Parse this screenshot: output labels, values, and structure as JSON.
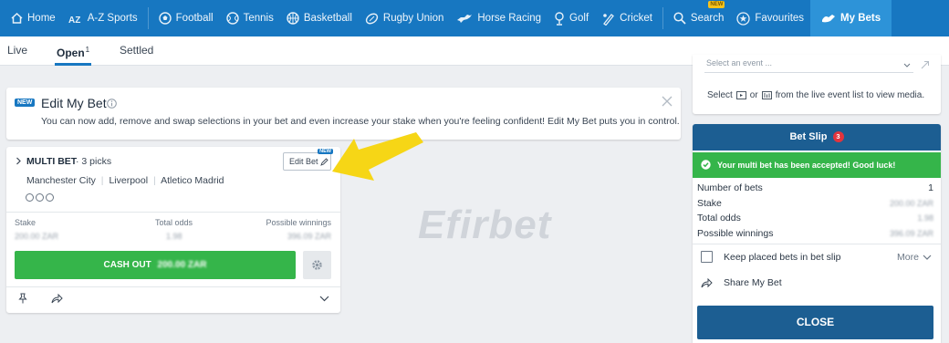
{
  "nav": {
    "items": [
      {
        "label": "Home",
        "icon": "home-icon"
      },
      {
        "label": "A-Z Sports",
        "icon": "az-sports-icon"
      },
      {
        "label": "Football",
        "icon": "football-icon"
      },
      {
        "label": "Tennis",
        "icon": "tennis-icon"
      },
      {
        "label": "Basketball",
        "icon": "basketball-icon"
      },
      {
        "label": "Rugby Union",
        "icon": "rugby-icon"
      },
      {
        "label": "Horse Racing",
        "icon": "horse-racing-icon"
      },
      {
        "label": "Golf",
        "icon": "golf-icon"
      },
      {
        "label": "Cricket",
        "icon": "cricket-icon"
      },
      {
        "label": "Search",
        "icon": "search-icon",
        "badge": "NEW"
      },
      {
        "label": "Favourites",
        "icon": "star-icon"
      },
      {
        "label": "My Bets",
        "icon": "my-bets-icon"
      }
    ]
  },
  "subtabs": {
    "live": "Live",
    "open": "Open",
    "open_count": "1",
    "settled": "Settled"
  },
  "promo": {
    "badge": "NEW",
    "title": "Edit My Bet",
    "text": "You can now add, remove and swap selections in your bet and even increase your stake when you're feeling confident! Edit My Bet puts you in control."
  },
  "bet": {
    "type": "MULTI BET",
    "picks": "· 3 picks",
    "edit_label": "Edit Bet",
    "edit_badge": "NEW",
    "selections": [
      "Manchester City",
      "Liverpool",
      "Atletico Madrid"
    ],
    "stake_label": "Stake",
    "odds_label": "Total odds",
    "winnings_label": "Possible winnings",
    "stake_value": "200.00 ZAR",
    "odds_value": "1.98",
    "winnings_value": "396.09 ZAR",
    "cashout_label": "CASH OUT",
    "cashout_value": "200.00 ZAR"
  },
  "watermark": "Efirbet",
  "media": {
    "select_placeholder": "Select an event ...",
    "text_select": "Select",
    "text_or": "or",
    "text_rest": "from the live event list to view media."
  },
  "betslip": {
    "title": "Bet Slip",
    "count": "3",
    "success": "Your multi bet has been accepted! Good luck!",
    "rows": [
      {
        "label": "Number of bets",
        "value": "1"
      },
      {
        "label": "Stake",
        "value": "200.00 ZAR"
      },
      {
        "label": "Total odds",
        "value": "1.98"
      },
      {
        "label": "Possible winnings",
        "value": "396.09 ZAR"
      }
    ],
    "keep_label": "Keep placed bets in bet slip",
    "more_label": "More",
    "share_label": "Share My Bet",
    "close_label": "CLOSE"
  },
  "colors": {
    "brand": "#1777c1",
    "success": "#35b54a",
    "header_dark": "#1c5e92",
    "arrow": "#f6d616"
  }
}
